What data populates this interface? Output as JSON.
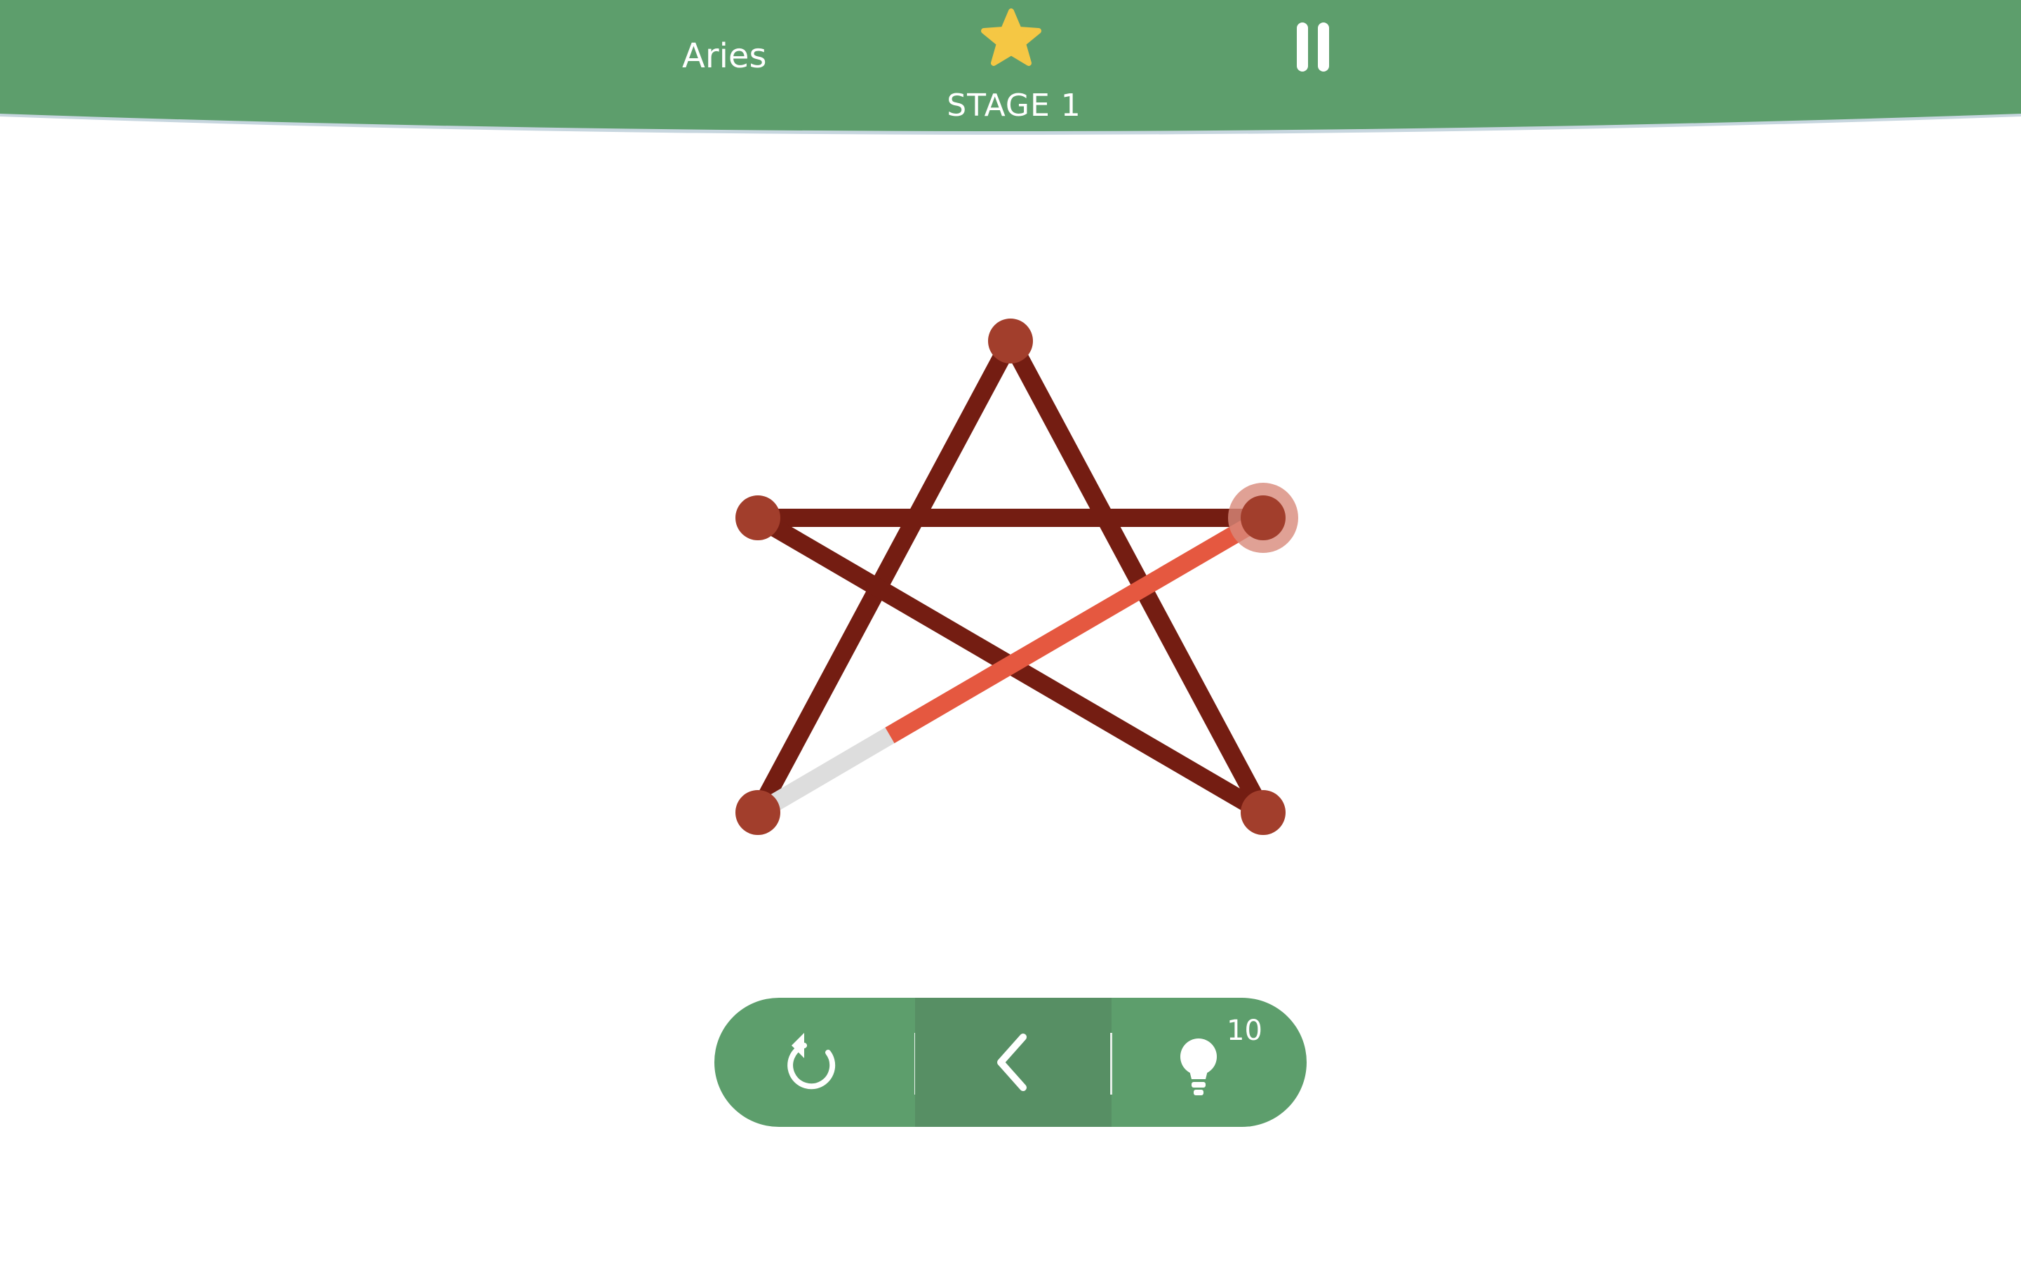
{
  "header": {
    "world_name": "Aries",
    "stage_label": "STAGE 1",
    "star_icon": "star-icon",
    "pause_icon": "pause-icon"
  },
  "puzzle": {
    "shape": "pentagram",
    "nodes": 5,
    "active_node": "right",
    "segments_total": 5,
    "segments_completed": 0
  },
  "toolbar": {
    "restart_icon": "restart-icon",
    "undo_icon": "chevron-left-icon",
    "hint_icon": "lightbulb-icon",
    "hint_count": "10"
  },
  "colors": {
    "header_green": "#5d9e6c",
    "header_edge": "#c7d6df",
    "line_dark": "#741d12",
    "node": "#a23e2c",
    "active_stroke": "#e55840",
    "remaining_stroke": "#dddddd",
    "active_halo": "#d88a7b",
    "star_yellow": "#f5c744",
    "toolbar_green": "#5d9e6c",
    "toolbar_active": "#578f64"
  }
}
